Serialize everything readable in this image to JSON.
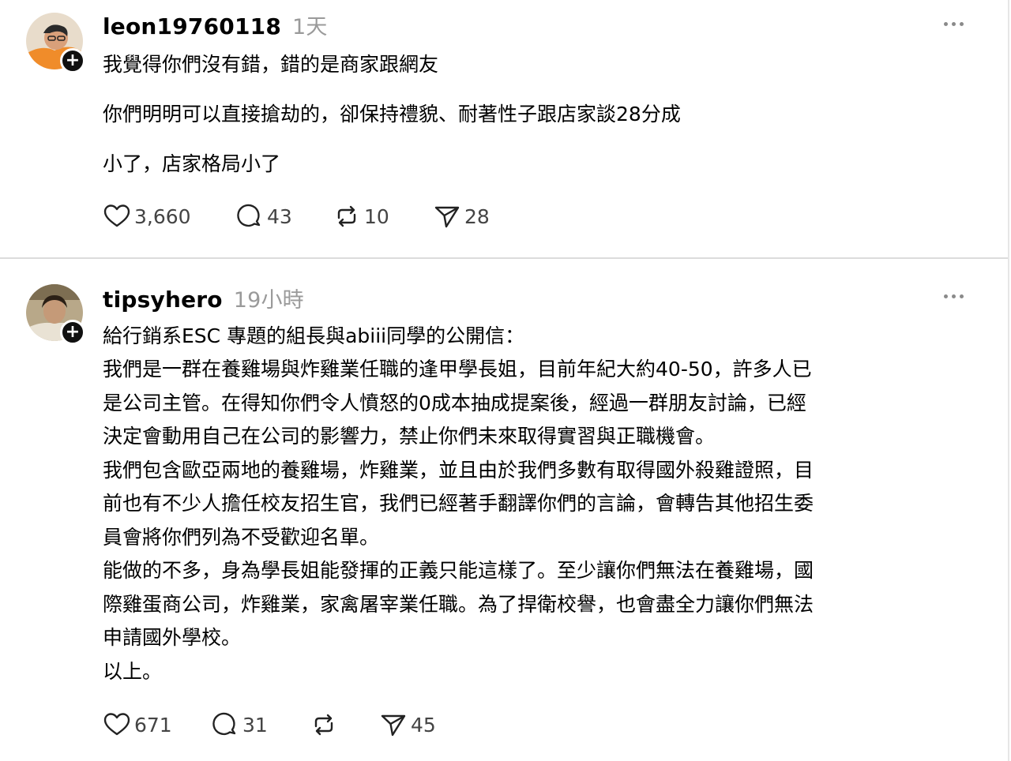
{
  "posts": [
    {
      "username": "leon19760118",
      "time": "1天",
      "lines": [
        "我覺得你們沒有錯，錯的是商家跟網友",
        "你們明明可以直接搶劫的，卻保持禮貌、耐著性子跟店家談28分成",
        "小了，店家格局小了"
      ],
      "stats": {
        "likes": "3,660",
        "replies": "43",
        "reposts": "10",
        "shares": "28"
      }
    },
    {
      "username": "tipsyhero",
      "time": "19小時",
      "lines": [
        "給行銷系ESC 專題的組長與abiii同學的公開信：",
        "我們是一群在養雞場與炸雞業任職的逢甲學長姐，目前年紀大約40-50，許多人已",
        "是公司主管。在得知你們令人憤怒的0成本抽成提案後，經過一群朋友討論，已經",
        "決定會動用自己在公司的影響力，禁止你們未來取得實習與正職機會。",
        "我們包含歐亞兩地的養雞場，炸雞業，並且由於我們多數有取得國外殺雞證照，目",
        "前也有不少人擔任校友招生官，我們已經著手翻譯你們的言論，會轉告其他招生委",
        "員會將你們列為不受歡迎名單。",
        "能做的不多，身為學長姐能發揮的正義只能這樣了。至少讓你們無法在養雞場，國",
        "際雞蛋商公司，炸雞業，家禽屠宰業任職。為了捍衛校譽，也會盡全力讓你們無法",
        "申請國外學校。",
        "以上。"
      ],
      "stats": {
        "likes": "671",
        "replies": "31",
        "reposts": "",
        "shares": "45"
      }
    }
  ],
  "icons": {
    "more": "more-horizontal-icon",
    "follow": "plus-icon",
    "like": "heart-icon",
    "reply": "comment-icon",
    "repost": "repost-icon",
    "share": "send-icon"
  }
}
